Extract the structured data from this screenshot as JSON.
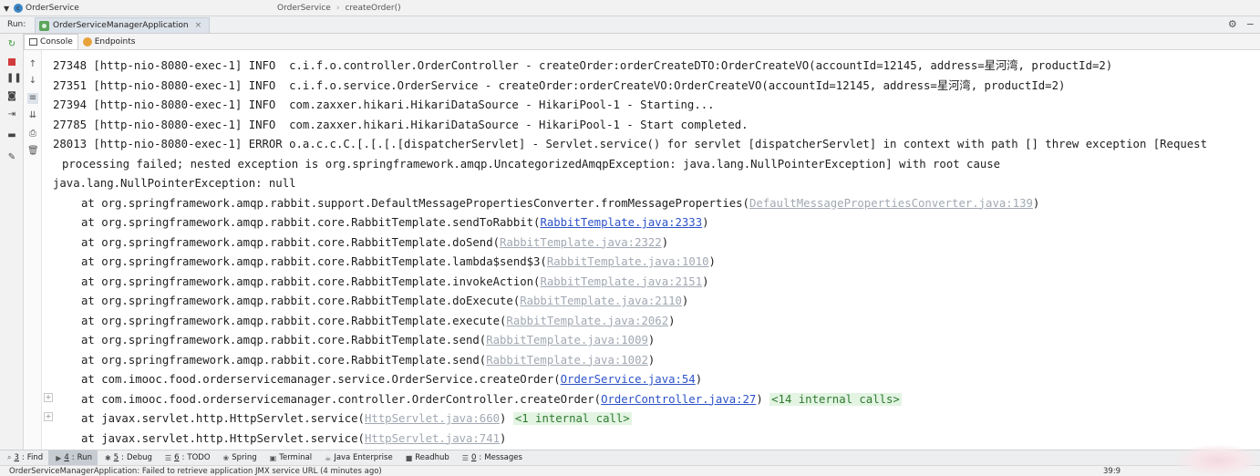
{
  "top": {
    "tree_item": "OrderService",
    "breadcrumb": [
      "OrderService",
      "createOrder()"
    ]
  },
  "run": {
    "label": "Run:",
    "tab": "OrderServiceManagerApplication"
  },
  "subtabs": [
    "Console",
    "Endpoints"
  ],
  "console": {
    "lines": [
      {
        "kind": "log",
        "text": "27348 [http-nio-8080-exec-1] INFO  c.i.f.o.controller.OrderController - createOrder:orderCreateDTO:OrderCreateVO(accountId=12145, address=星河湾, productId=2)"
      },
      {
        "kind": "log",
        "text": "27351 [http-nio-8080-exec-1] INFO  c.i.f.o.service.OrderService - createOrder:orderCreateVO:OrderCreateVO(accountId=12145, address=星河湾, productId=2)"
      },
      {
        "kind": "log",
        "text": "27394 [http-nio-8080-exec-1] INFO  com.zaxxer.hikari.HikariDataSource - HikariPool-1 - Starting..."
      },
      {
        "kind": "log",
        "text": "27785 [http-nio-8080-exec-1] INFO  com.zaxxer.hikari.HikariDataSource - HikariPool-1 - Start completed."
      },
      {
        "kind": "log",
        "text": "28013 [http-nio-8080-exec-1] ERROR o.a.c.c.C.[.[.[.[dispatcherServlet] - Servlet.service() for servlet [dispatcherServlet] in context with path [] threw exception [Request"
      },
      {
        "kind": "cont",
        "text": "processing failed; nested exception is org.springframework.amqp.UncategorizedAmqpException: java.lang.NullPointerException] with root cause"
      },
      {
        "kind": "plain",
        "text": "java.lang.NullPointerException: null"
      },
      {
        "kind": "trace",
        "prefix": "at org.springframework.amqp.rabbit.support.DefaultMessagePropertiesConverter.fromMessageProperties(",
        "link": "DefaultMessagePropertiesConverter.java:139",
        "link_style": "gray",
        "suffix": ")"
      },
      {
        "kind": "trace",
        "prefix": "at org.springframework.amqp.rabbit.core.RabbitTemplate.sendToRabbit(",
        "link": "RabbitTemplate.java:2333",
        "link_style": "blue",
        "suffix": ")"
      },
      {
        "kind": "trace",
        "prefix": "at org.springframework.amqp.rabbit.core.RabbitTemplate.doSend(",
        "link": "RabbitTemplate.java:2322",
        "link_style": "gray",
        "suffix": ")"
      },
      {
        "kind": "trace",
        "prefix": "at org.springframework.amqp.rabbit.core.RabbitTemplate.lambda$send$3(",
        "link": "RabbitTemplate.java:1010",
        "link_style": "gray",
        "suffix": ")"
      },
      {
        "kind": "trace",
        "prefix": "at org.springframework.amqp.rabbit.core.RabbitTemplate.invokeAction(",
        "link": "RabbitTemplate.java:2151",
        "link_style": "gray",
        "suffix": ")"
      },
      {
        "kind": "trace",
        "prefix": "at org.springframework.amqp.rabbit.core.RabbitTemplate.doExecute(",
        "link": "RabbitTemplate.java:2110",
        "link_style": "gray",
        "suffix": ")"
      },
      {
        "kind": "trace",
        "prefix": "at org.springframework.amqp.rabbit.core.RabbitTemplate.execute(",
        "link": "RabbitTemplate.java:2062",
        "link_style": "gray",
        "suffix": ")"
      },
      {
        "kind": "trace",
        "prefix": "at org.springframework.amqp.rabbit.core.RabbitTemplate.send(",
        "link": "RabbitTemplate.java:1009",
        "link_style": "gray",
        "suffix": ")"
      },
      {
        "kind": "trace",
        "prefix": "at org.springframework.amqp.rabbit.core.RabbitTemplate.send(",
        "link": "RabbitTemplate.java:1002",
        "link_style": "gray",
        "suffix": ")"
      },
      {
        "kind": "trace",
        "prefix": "at com.imooc.food.orderservicemanager.service.OrderService.createOrder(",
        "link": "OrderService.java:54",
        "link_style": "blue",
        "suffix": ")"
      },
      {
        "kind": "trace",
        "prefix": "at com.imooc.food.orderservicemanager.controller.OrderController.createOrder(",
        "link": "OrderController.java:27",
        "link_style": "blue",
        "suffix": ") ",
        "internal": "<14 internal calls>"
      },
      {
        "kind": "trace",
        "prefix": "at javax.servlet.http.HttpServlet.service(",
        "link": "HttpServlet.java:660",
        "link_style": "gray",
        "suffix": ") ",
        "internal": "<1 internal call>"
      },
      {
        "kind": "trace",
        "prefix": "at javax.servlet.http.HttpServlet.service(",
        "link": "HttpServlet.java:741",
        "link_style": "gray",
        "suffix": ")"
      }
    ]
  },
  "bottom_tabs": [
    {
      "key": "3",
      "label": "Find",
      "icon": "search-icon"
    },
    {
      "key": "4",
      "label": "Run",
      "icon": "run-icon",
      "active": true
    },
    {
      "key": "5",
      "label": "Debug",
      "icon": "debug-icon"
    },
    {
      "key": "6",
      "label": "TODO",
      "icon": "todo-icon"
    },
    {
      "key": "",
      "label": "Spring",
      "icon": "spring-icon"
    },
    {
      "key": "",
      "label": "Terminal",
      "icon": "terminal-icon"
    },
    {
      "key": "",
      "label": "Java Enterprise",
      "icon": "java-enterprise-icon"
    },
    {
      "key": "",
      "label": "Readhub",
      "icon": "readhub-icon"
    },
    {
      "key": "0",
      "label": "Messages",
      "icon": "messages-icon"
    }
  ],
  "status": {
    "message": "OrderServiceManagerApplication: Failed to retrieve application JMX service URL (4 minutes ago)",
    "position": "39:9"
  },
  "colors": {
    "link_blue": "#2c52c9",
    "link_gray": "#a2a8b2",
    "internal_bg": "#e3f4e3",
    "internal_fg": "#2f7a2f",
    "rerun_green": "#3a9a3a",
    "stop_red": "#d23b3b"
  }
}
